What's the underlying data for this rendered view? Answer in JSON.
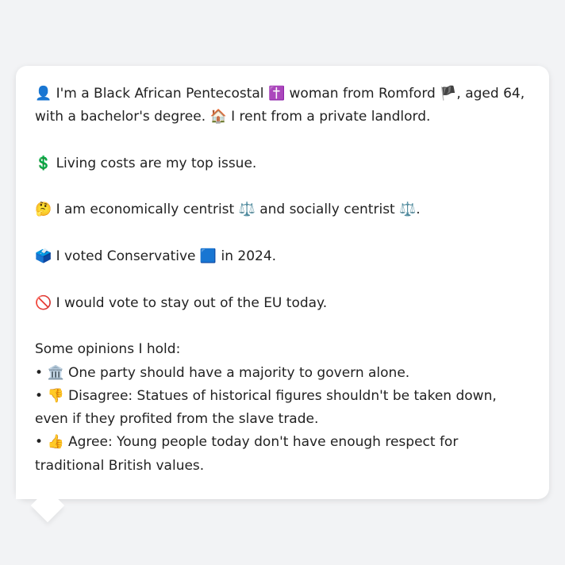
{
  "profile": {
    "intro": {
      "icon": "👤",
      "text_1": "I'm a Black African Pentecostal",
      "religion_icon": "✝️",
      "text_2": "woman from Romford",
      "flag_icon": "🏴",
      "text_3": ", aged 64, with a bachelor's degree.",
      "home_icon": "🏠",
      "text_4": "I rent from a private landlord."
    },
    "issue": {
      "icon": "💲",
      "text": "Living costs are my top issue."
    },
    "ideology": {
      "icon": "🤔",
      "text_1": "I am economically centrist",
      "scale_icon_1": "⚖️",
      "text_2": "and socially centrist",
      "scale_icon_2": "⚖️",
      "text_3": "."
    },
    "vote": {
      "icon": "🗳️",
      "text_1": "I voted Conservative",
      "party_icon": "🟦",
      "text_2": "in 2024."
    },
    "eu": {
      "icon": "🚫",
      "text": "I would vote to stay out of the EU today."
    },
    "opinions": {
      "heading": "Some opinions I hold:",
      "bullet": "•",
      "items": [
        {
          "icon": "🏛️",
          "text": "One party should have a majority to govern alone."
        },
        {
          "icon": "👎",
          "text": "Disagree: Statues of historical figures shouldn't be taken down, even if they profited from the slave trade."
        },
        {
          "icon": "👍",
          "text": "Agree: Young people today don't have enough respect for traditional British values."
        }
      ]
    }
  },
  "colors": {
    "background": "#f2f3f5",
    "bubble": "#ffffff",
    "text": "#222222"
  }
}
